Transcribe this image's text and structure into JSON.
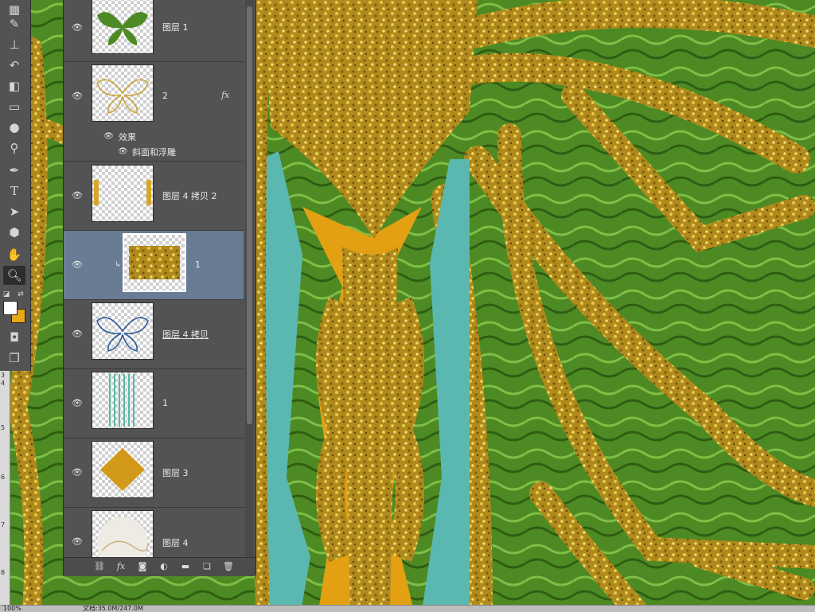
{
  "tools": [
    {
      "icon": "artboard-icon"
    },
    {
      "icon": "brush-icon"
    },
    {
      "icon": "stamp-icon"
    },
    {
      "icon": "history-brush-icon"
    },
    {
      "icon": "eraser-icon"
    },
    {
      "icon": "gradient-icon"
    },
    {
      "icon": "blur-drop-icon"
    },
    {
      "icon": "dodge-icon"
    },
    {
      "icon": "pen-icon"
    },
    {
      "icon": "type-icon",
      "glyph": "T"
    },
    {
      "icon": "path-select-icon"
    },
    {
      "icon": "shape-icon"
    },
    {
      "icon": "hand-icon"
    },
    {
      "icon": "zoom-icon"
    }
  ],
  "colors": {
    "foreground": "#ffffff",
    "background": "#e7a716",
    "selection": "#6a7b94",
    "panel": "#535353"
  },
  "ruler_labels": [
    "3",
    "4",
    "5",
    "6",
    "7",
    "8"
  ],
  "layers": [
    {
      "name": "图层 1",
      "thumb": "green-butterfly",
      "visible": true
    },
    {
      "name": "2",
      "thumb": "gold-butterfly-outline",
      "visible": true,
      "fx": "fx",
      "effects_label": "效果",
      "effects": [
        "斜面和浮雕"
      ]
    },
    {
      "name": "图层 4 拷贝 2",
      "thumb": "gold-side-strips",
      "visible": true
    },
    {
      "name": "1",
      "thumb": "gold-glitter",
      "visible": true,
      "selected": true,
      "clipped": true
    },
    {
      "name": "图层 4 拷贝",
      "thumb": "blue-butterfly-outline",
      "visible": true
    },
    {
      "name": "1",
      "thumb": "teal-stripes",
      "visible": true
    },
    {
      "name": "图层 3",
      "thumb": "gold-diamond",
      "visible": true
    },
    {
      "name": "图层 4",
      "thumb": "marble-circle",
      "visible": true
    }
  ],
  "layer_footer": [
    "link-icon",
    "fx-icon",
    "mask-icon",
    "adjustment-icon",
    "folder-icon",
    "new-layer-icon",
    "trash-icon"
  ],
  "status": {
    "zoom": "100%",
    "doc": "文档:35.0M/247.0M"
  }
}
